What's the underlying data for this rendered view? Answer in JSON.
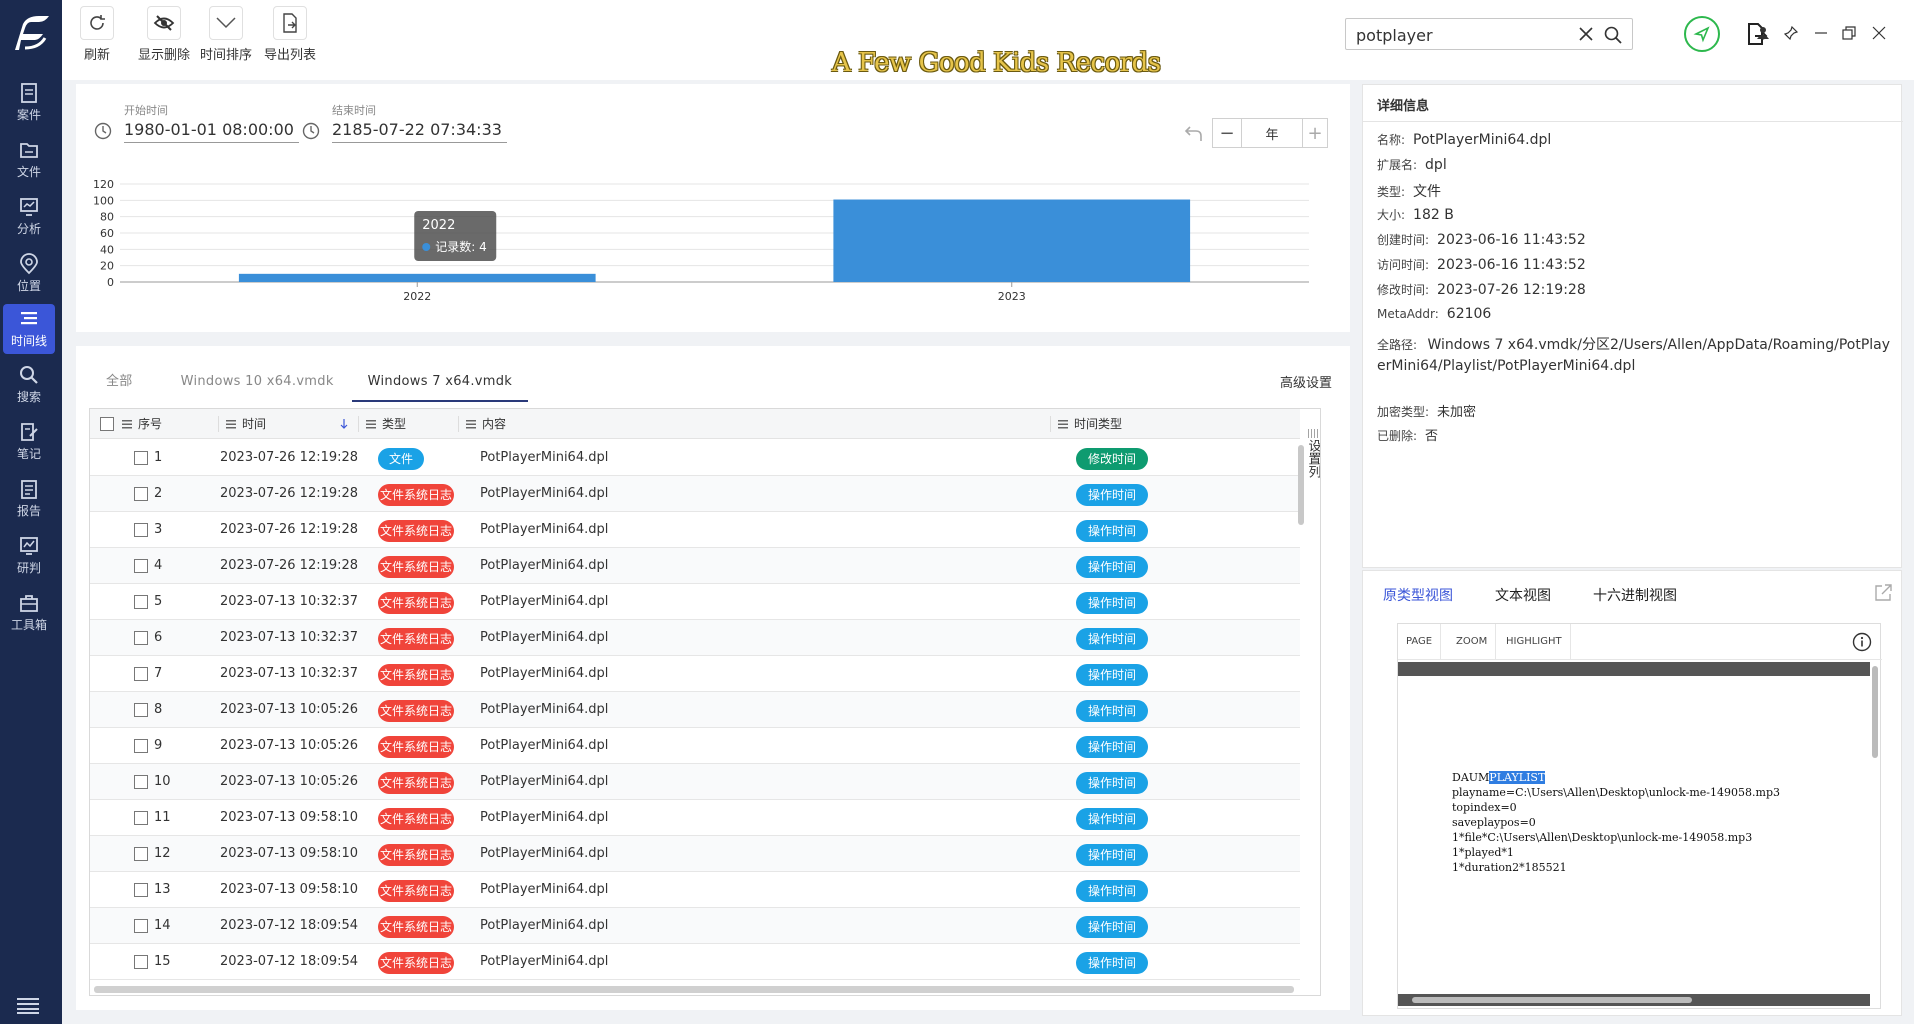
{
  "sidebar": {
    "items": [
      {
        "label": "案件",
        "icon": "case-icon"
      },
      {
        "label": "文件",
        "icon": "folder-icon"
      },
      {
        "label": "分析",
        "icon": "analysis-icon"
      },
      {
        "label": "位置",
        "icon": "location-icon"
      },
      {
        "label": "时间线",
        "icon": "timeline-icon",
        "active": true
      },
      {
        "label": "搜索",
        "icon": "search-icon"
      },
      {
        "label": "笔记",
        "icon": "note-icon"
      },
      {
        "label": "报告",
        "icon": "report-icon"
      },
      {
        "label": "研判",
        "icon": "judge-icon"
      },
      {
        "label": "工具箱",
        "icon": "toolbox-icon"
      }
    ]
  },
  "toolbar": {
    "refresh": "刷新",
    "show_deleted": "显示删除",
    "time_sort": "时间排序",
    "export_list": "导出列表"
  },
  "banner": "A Few Good Kids Records",
  "search": {
    "value": "potplayer"
  },
  "timeline": {
    "start_label": "开始时间",
    "start_value": "1980-01-01 08:00:00",
    "end_label": "结束时间",
    "end_value": "2185-07-22 07:34:33",
    "unit": "年",
    "minus": "−",
    "plus": "+"
  },
  "chart_data": {
    "type": "bar",
    "categories": [
      "2022",
      "2023"
    ],
    "series": [
      {
        "name": "记录数",
        "values": [
          10,
          101
        ]
      }
    ],
    "ylim": [
      0,
      120
    ],
    "yticks": [
      0,
      20,
      40,
      60,
      80,
      100,
      120
    ],
    "tooltip": {
      "title": "2022",
      "label": "记录数: 4"
    },
    "color": "#3a8fd9",
    "grid": true
  },
  "tabs": {
    "items": [
      "全部",
      "Windows 10 x64.vmdk",
      "Windows 7 x64.vmdk"
    ],
    "active_index": 2,
    "advanced": "高级设置"
  },
  "table": {
    "headers": {
      "seq": "序号",
      "time": "时间",
      "type": "类型",
      "content": "内容",
      "time_type": "时间类型"
    },
    "settings_col": "设置列",
    "rows": [
      {
        "seq": "1",
        "time": "2023-07-26 12:19:28",
        "type": "文件",
        "content": "PotPlayerMini64.dpl",
        "time_type": "修改时间"
      },
      {
        "seq": "2",
        "time": "2023-07-26 12:19:28",
        "type": "文件系统日志",
        "content": "PotPlayerMini64.dpl",
        "time_type": "操作时间"
      },
      {
        "seq": "3",
        "time": "2023-07-26 12:19:28",
        "type": "文件系统日志",
        "content": "PotPlayerMini64.dpl",
        "time_type": "操作时间"
      },
      {
        "seq": "4",
        "time": "2023-07-26 12:19:28",
        "type": "文件系统日志",
        "content": "PotPlayerMini64.dpl",
        "time_type": "操作时间"
      },
      {
        "seq": "5",
        "time": "2023-07-13 10:32:37",
        "type": "文件系统日志",
        "content": "PotPlayerMini64.dpl",
        "time_type": "操作时间"
      },
      {
        "seq": "6",
        "time": "2023-07-13 10:32:37",
        "type": "文件系统日志",
        "content": "PotPlayerMini64.dpl",
        "time_type": "操作时间"
      },
      {
        "seq": "7",
        "time": "2023-07-13 10:32:37",
        "type": "文件系统日志",
        "content": "PotPlayerMini64.dpl",
        "time_type": "操作时间"
      },
      {
        "seq": "8",
        "time": "2023-07-13 10:05:26",
        "type": "文件系统日志",
        "content": "PotPlayerMini64.dpl",
        "time_type": "操作时间"
      },
      {
        "seq": "9",
        "time": "2023-07-13 10:05:26",
        "type": "文件系统日志",
        "content": "PotPlayerMini64.dpl",
        "time_type": "操作时间"
      },
      {
        "seq": "10",
        "time": "2023-07-13 10:05:26",
        "type": "文件系统日志",
        "content": "PotPlayerMini64.dpl",
        "time_type": "操作时间"
      },
      {
        "seq": "11",
        "time": "2023-07-13 09:58:10",
        "type": "文件系统日志",
        "content": "PotPlayerMini64.dpl",
        "time_type": "操作时间"
      },
      {
        "seq": "12",
        "time": "2023-07-13 09:58:10",
        "type": "文件系统日志",
        "content": "PotPlayerMini64.dpl",
        "time_type": "操作时间"
      },
      {
        "seq": "13",
        "time": "2023-07-13 09:58:10",
        "type": "文件系统日志",
        "content": "PotPlayerMini64.dpl",
        "time_type": "操作时间"
      },
      {
        "seq": "14",
        "time": "2023-07-12 18:09:54",
        "type": "文件系统日志",
        "content": "PotPlayerMini64.dpl",
        "time_type": "操作时间"
      },
      {
        "seq": "15",
        "time": "2023-07-12 18:09:54",
        "type": "文件系统日志",
        "content": "PotPlayerMini64.dpl",
        "time_type": "操作时间"
      }
    ]
  },
  "colors": {
    "sidebar_bg": "#1b2a4f",
    "active": "#3b56d8",
    "pill_file": "#1aa2e6",
    "pill_fslog": "#f0443a",
    "pill_modify": "#0e9b70",
    "pill_op": "#1aa2e6"
  },
  "detail": {
    "title": "详细信息",
    "fields": [
      {
        "k": "名称:",
        "v": "PotPlayerMini64.dpl"
      },
      {
        "k": "扩展名:",
        "v": "dpl"
      },
      {
        "k": "类型:",
        "v": "文件"
      },
      {
        "k": "大小:",
        "v": "182 B"
      },
      {
        "k": "创建时间:",
        "v": "2023-06-16 11:43:52"
      },
      {
        "k": "访问时间:",
        "v": "2023-06-16 11:43:52"
      },
      {
        "k": "修改时间:",
        "v": "2023-07-26 12:19:28"
      },
      {
        "k": "MetaAddr:",
        "v": "62106"
      }
    ],
    "path_key": "全路径:",
    "path_value": "Windows 7 x64.vmdk/分区2/Users/Allen/AppData/Roaming/PotPlayerMini64/Playlist/PotPlayerMini64.dpl",
    "encrypt_key": "加密类型:",
    "encrypt_value": "未加密",
    "deleted_key": "已删除:",
    "deleted_value": "否"
  },
  "preview": {
    "tabs": [
      "原类型视图",
      "文本视图",
      "十六进制视图"
    ],
    "viewer_buttons": [
      "PAGE",
      "ZOOM",
      "HIGHLIGHT"
    ],
    "text_prefix": "DAUM",
    "text_highlight": "PLAYLIST",
    "text_rest": "\nplayname=C:\\Users\\Allen\\Desktop\\unlock-me-149058.mp3\ntopindex=0\nsaveplaypos=0\n1*file*C:\\Users\\Allen\\Desktop\\unlock-me-149058.mp3\n1*played*1\n1*duration2*185521"
  }
}
